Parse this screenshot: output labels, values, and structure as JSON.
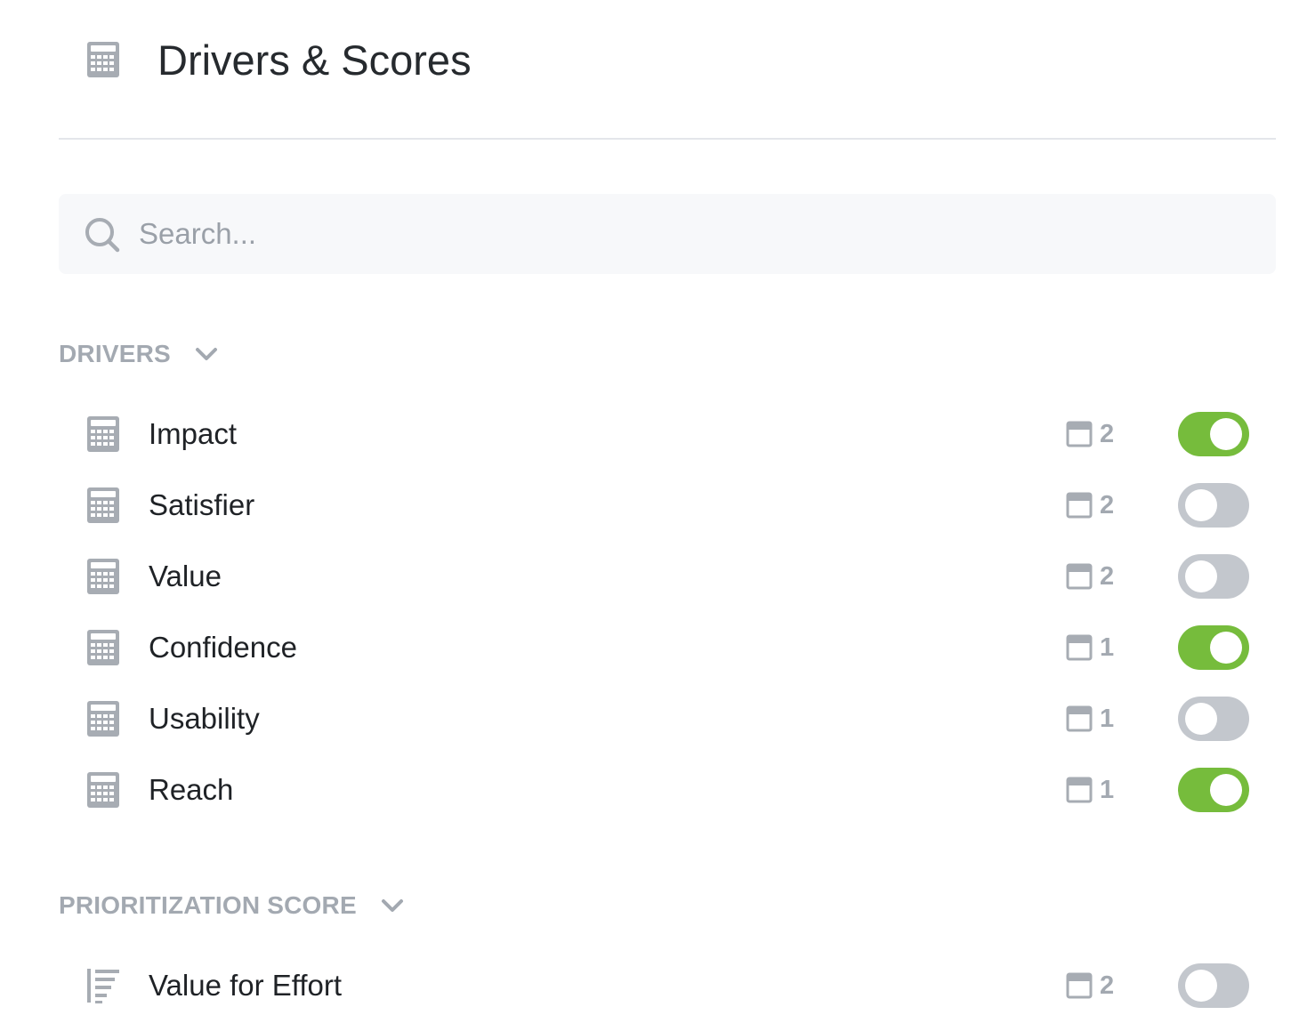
{
  "header": {
    "title": "Drivers & Scores",
    "icon": "calculator-icon"
  },
  "search": {
    "placeholder": "Search..."
  },
  "drivers_section": {
    "label": "DRIVERS",
    "items": [
      {
        "label": "Impact",
        "count": "2",
        "enabled": true
      },
      {
        "label": "Satisfier",
        "count": "2",
        "enabled": false
      },
      {
        "label": "Value",
        "count": "2",
        "enabled": false
      },
      {
        "label": "Confidence",
        "count": "1",
        "enabled": true
      },
      {
        "label": "Usability",
        "count": "1",
        "enabled": false
      },
      {
        "label": "Reach",
        "count": "1",
        "enabled": true
      }
    ]
  },
  "score_section": {
    "label": "PRIORITIZATION SCORE",
    "items": [
      {
        "label": "Value for Effort",
        "count": "2",
        "enabled": false
      }
    ]
  },
  "colors": {
    "toggle_on": "#76bc3c",
    "toggle_off": "#c3c7cd",
    "muted_text": "#a3a9b1",
    "icon_gray": "#a7acb3"
  }
}
